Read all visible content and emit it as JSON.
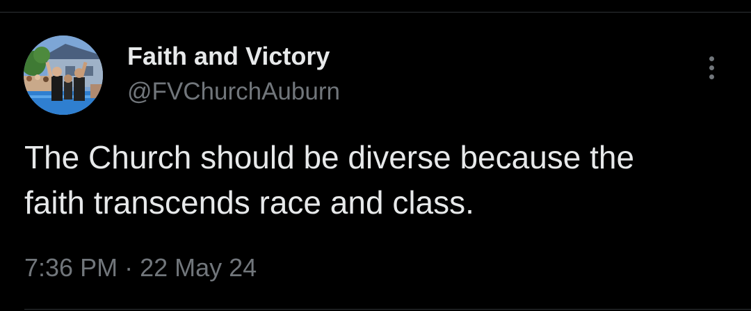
{
  "tweet": {
    "author": {
      "display_name": "Faith and Victory",
      "handle": "@FVChurchAuburn",
      "avatar_icon": "profile-photo-baptism"
    },
    "text": "The Church should be diverse because the\nfaith transcends race and class.",
    "time": "7:36 PM",
    "separator": "·",
    "date": "22 May 24",
    "more_icon": "more-vertical-icon"
  },
  "colors": {
    "background": "#000000",
    "primary_text": "#e7e9ea",
    "secondary_text": "#71767b",
    "divider": "#2f3336"
  }
}
